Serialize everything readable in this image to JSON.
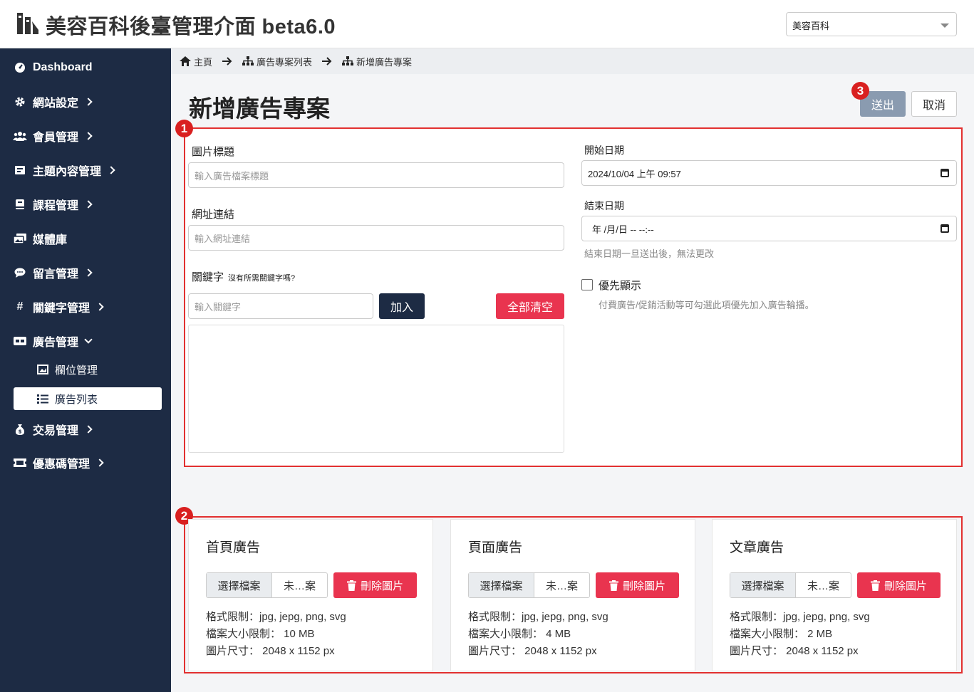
{
  "header": {
    "title": "美容百科後臺管理介面 beta6.0",
    "site_select": "美容百科"
  },
  "sidebar": {
    "items": [
      {
        "label": "Dashboard",
        "icon": "dashboard-icon"
      },
      {
        "label": "網站設定",
        "icon": "gear-icon"
      },
      {
        "label": "會員管理",
        "icon": "users-icon"
      },
      {
        "label": "主題內容管理",
        "icon": "book-icon"
      },
      {
        "label": "課程管理",
        "icon": "book-closed-icon"
      },
      {
        "label": "媒體庫",
        "icon": "images-icon"
      },
      {
        "label": "留言管理",
        "icon": "comment-icon"
      },
      {
        "label": "關鍵字管理",
        "icon": "hashtag-icon"
      },
      {
        "label": "廣告管理",
        "icon": "ad-icon"
      },
      {
        "label": "交易管理",
        "icon": "money-bag-icon"
      },
      {
        "label": "優惠碼管理",
        "icon": "ticket-icon"
      }
    ],
    "sub_items": [
      {
        "label": "欄位管理",
        "icon": "image-frame-icon"
      },
      {
        "label": "廣告列表",
        "icon": "list-icon"
      }
    ]
  },
  "breadcrumb": [
    "主頁",
    "廣告專案列表",
    "新增廣告專案"
  ],
  "page": {
    "title": "新增廣告專案",
    "send_label": "送出",
    "cancel_label": "取消"
  },
  "badges": [
    "1",
    "2",
    "3"
  ],
  "form": {
    "image_title_label": "圖片標題",
    "image_title_placeholder": "輸入廣告檔案標題",
    "url_label": "網址連結",
    "url_placeholder": "輸入網址連結",
    "keyword_label": "關鍵字",
    "keyword_hint": "沒有所需關鍵字嗎?",
    "keyword_placeholder": "輸入關鍵字",
    "add_label": "加入",
    "clear_label": "全部清空",
    "start_label": "開始日期",
    "start_value": "2024/10/04 上午 09:57",
    "end_label": "結束日期",
    "end_value": "年 /月/日 -- --:--",
    "end_hint": "結束日期一旦送出後，無法更改",
    "priority_label": "優先顯示",
    "priority_hint": "付費廣告/促銷活動等可勾選此項優先加入廣告輪播。"
  },
  "cards": [
    {
      "title": "首頁廣告",
      "choose": "選擇檔案",
      "file": "未…案",
      "delete": "刪除圖片",
      "format": "格式限制：jpg, jepg, png, svg",
      "size": "檔案大小限制： 10 MB",
      "dimension": "圖片尺寸： 2048 x 1152 px"
    },
    {
      "title": "頁面廣告",
      "choose": "選擇檔案",
      "file": "未…案",
      "delete": "刪除圖片",
      "format": "格式限制：jpg, jepg, png, svg",
      "size": "檔案大小限制： 4 MB",
      "dimension": "圖片尺寸： 2048 x 1152 px"
    },
    {
      "title": "文章廣告",
      "choose": "選擇檔案",
      "file": "未…案",
      "delete": "刪除圖片",
      "format": "格式限制：jpg, jepg, png, svg",
      "size": "檔案大小限制： 2 MB",
      "dimension": "圖片尺寸： 2048 x 1152 px"
    }
  ]
}
